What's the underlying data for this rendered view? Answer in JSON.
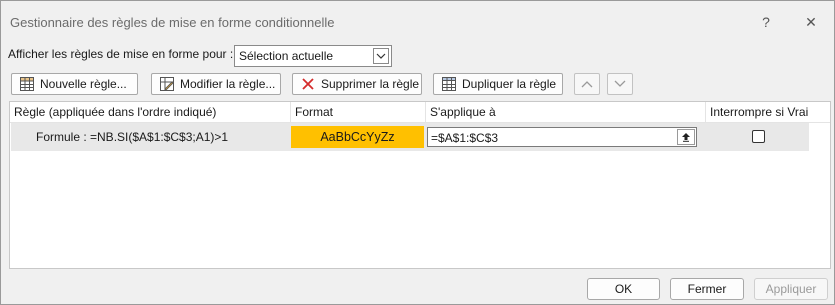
{
  "window": {
    "title": "Gestionnaire des règles de mise en forme conditionnelle",
    "help_label": "?",
    "close_label": "✕"
  },
  "show_rules": {
    "label": "Afficher les règles de mise en forme pour :",
    "selected": "Sélection actuelle"
  },
  "toolbar": {
    "new_rule": "Nouvelle règle...",
    "edit_rule": "Modifier la règle...",
    "delete_rule": "Supprimer la règle",
    "duplicate_rule": "Dupliquer la règle"
  },
  "table": {
    "headers": {
      "rule": "Règle (appliquée dans l'ordre indiqué)",
      "format": "Format",
      "applies_to": "S'applique à",
      "stop_if_true": "Interrompre si Vrai"
    },
    "rows": [
      {
        "rule": "Formule : =NB.SI($A$1:$C$3;A1)>1",
        "format_preview": "AaBbCcYyZz",
        "format_color": "#ffc000",
        "applies_to": "=$A$1:$C$3",
        "stop_if_true": false
      }
    ]
  },
  "footer": {
    "ok": "OK",
    "close": "Fermer",
    "apply": "Appliquer"
  }
}
